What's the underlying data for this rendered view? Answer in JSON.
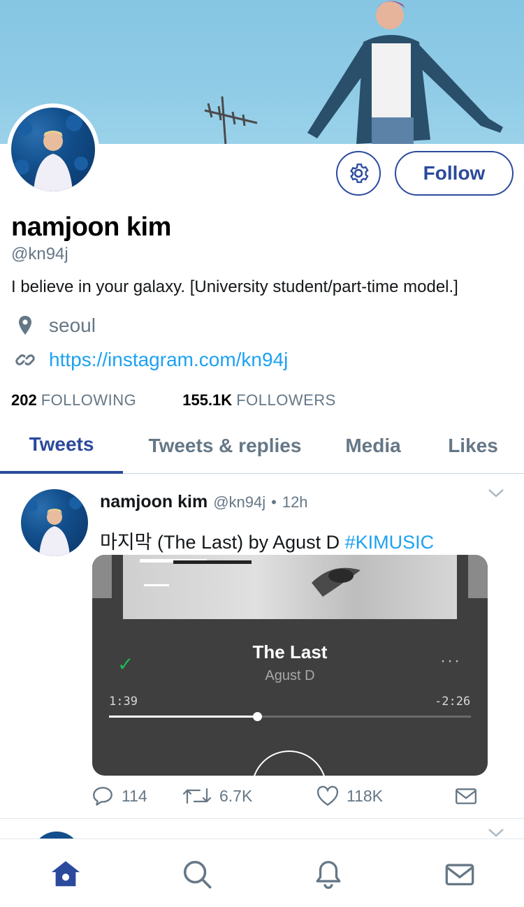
{
  "profile": {
    "name": "namjoon kim",
    "handle": "@kn94j",
    "bio": "I believe in your galaxy. [University student/part-time model.]",
    "location": "seoul",
    "link": "https://instagram.com/kn94j",
    "following_count": "202",
    "following_label": "FOLLOWING",
    "followers_count": "155.1K",
    "followers_label": "FOLLOWERS",
    "follow_button": "Follow",
    "icons": {
      "settings": "gear-icon",
      "location": "location-pin-icon",
      "link": "link-icon"
    }
  },
  "tabs": [
    {
      "label": "Tweets",
      "active": true
    },
    {
      "label": "Tweets & replies",
      "active": false
    },
    {
      "label": "Media",
      "active": false
    },
    {
      "label": "Likes",
      "active": false
    }
  ],
  "tweet": {
    "name": "namjoon kim",
    "handle": "@kn94j",
    "separator": "•",
    "time": "12h",
    "text": "마지막 (The Last) by Agust D ",
    "hashtag": "#KIMUSIC",
    "media": {
      "song_title": "The Last",
      "artist": "Agust D",
      "elapsed": "1:39",
      "remaining": "-2:26",
      "progress": 0.41,
      "more": "···",
      "saved_icon": "check-icon"
    },
    "actions": {
      "replies": "114",
      "retweets": "6.7K",
      "likes": "118K"
    }
  },
  "nav": [
    "home-icon",
    "search-icon",
    "bell-icon",
    "mail-icon"
  ],
  "colors": {
    "accent": "#2b4a9c",
    "link": "#1da1f2",
    "muted": "#657786",
    "banner_sky": "#8fcbe6",
    "spotify_green": "#1db954"
  }
}
